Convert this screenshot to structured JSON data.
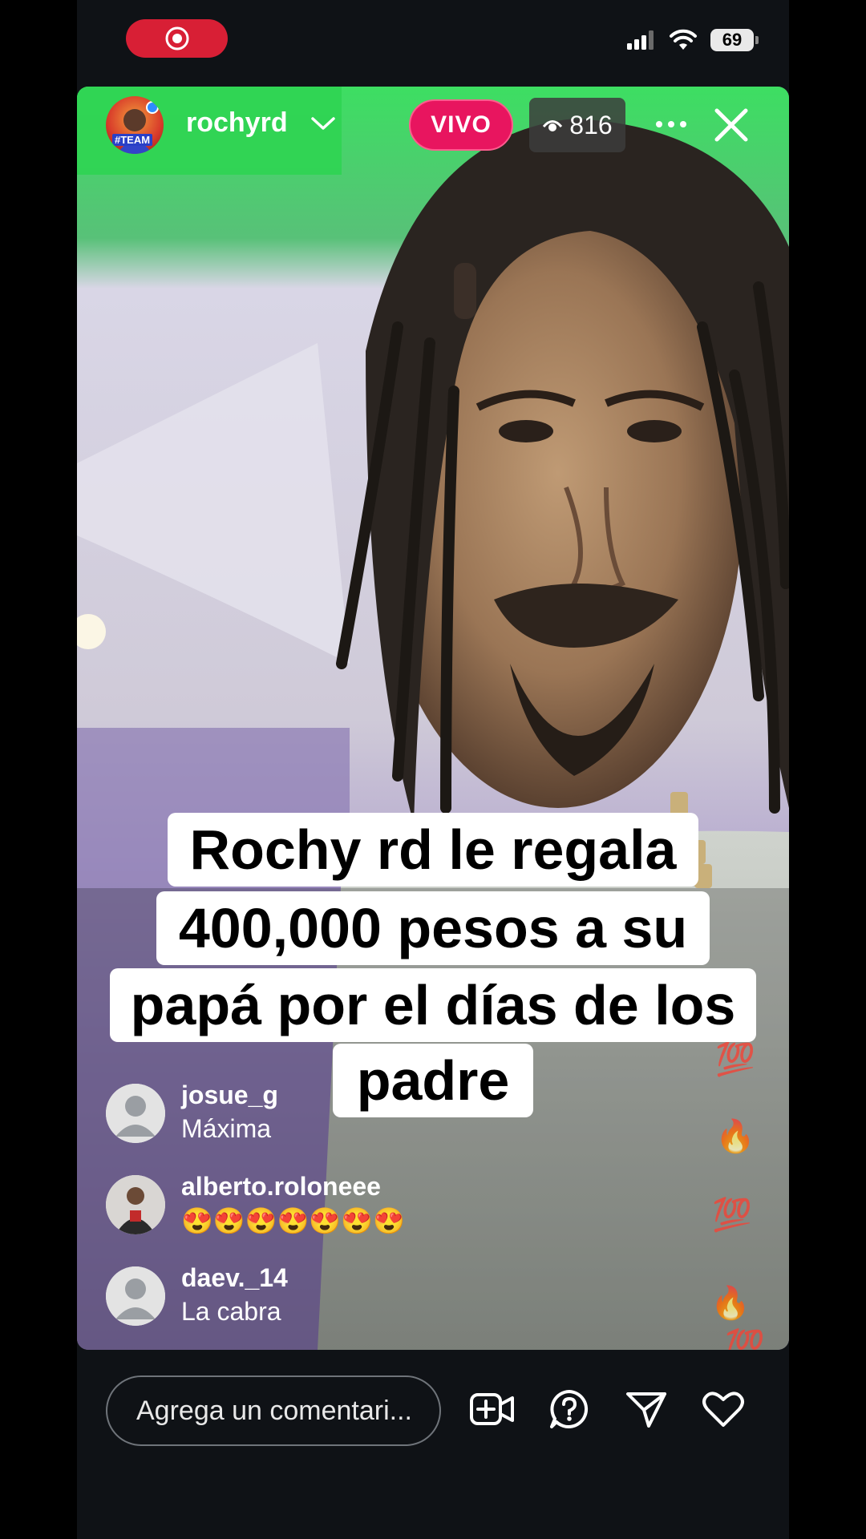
{
  "status_bar": {
    "battery": "69"
  },
  "live": {
    "host_name": "rochyrd",
    "host_badge": "#TEAM",
    "live_label": "VIVO",
    "viewer_count": "816"
  },
  "caption": {
    "lines": [
      "Rochy rd le regala",
      "400,000 pesos a su",
      "papá por el días de los",
      "padre"
    ]
  },
  "comments": [
    {
      "username": "josue_g",
      "text": "Máxima",
      "avatar": "default-avatar"
    },
    {
      "username": "alberto.roloneee",
      "text": "😍😍😍😍😍😍😍",
      "avatar": "photo-avatar"
    },
    {
      "username": "daev._14",
      "text": "La cabra",
      "avatar": "default-avatar"
    }
  ],
  "reactions": [
    "💯",
    "🔥",
    "💯",
    "🔥",
    "💯"
  ],
  "bottom_bar": {
    "comment_placeholder": "Agrega un comentari...",
    "icons": [
      "add-video-icon",
      "question-icon",
      "send-icon",
      "heart-icon"
    ]
  },
  "colors": {
    "live": "#e8155f",
    "record": "#d81f35",
    "background": "#0f1216"
  }
}
